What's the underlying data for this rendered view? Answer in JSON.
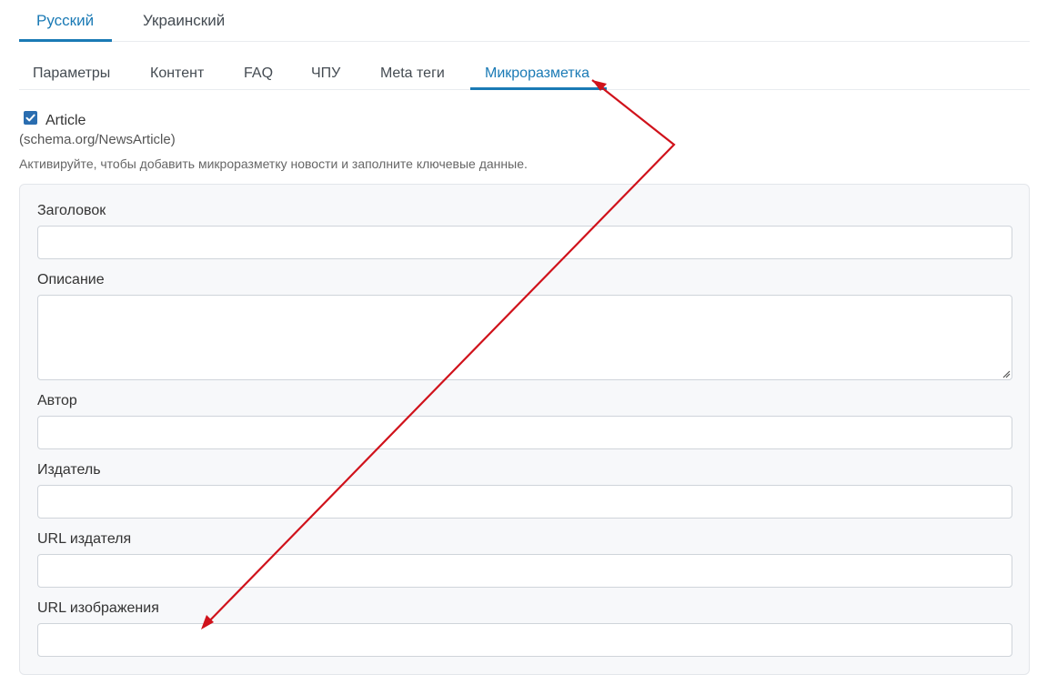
{
  "language_tabs": [
    {
      "label": "Русский",
      "active": true
    },
    {
      "label": "Украинский",
      "active": false
    }
  ],
  "sub_tabs": [
    {
      "label": "Параметры",
      "active": false
    },
    {
      "label": "Контент",
      "active": false
    },
    {
      "label": "FAQ",
      "active": false
    },
    {
      "label": "ЧПУ",
      "active": false
    },
    {
      "label": "Meta теги",
      "active": false
    },
    {
      "label": "Микроразметка",
      "active": true
    }
  ],
  "article_checkbox": {
    "checked": true,
    "label": "Article",
    "schema": "(schema.org/NewsArticle)",
    "help": "Активируйте, чтобы добавить микроразметку новости и заполните ключевые данные."
  },
  "fields": {
    "title": {
      "label": "Заголовок",
      "value": ""
    },
    "description": {
      "label": "Описание",
      "value": ""
    },
    "author": {
      "label": "Автор",
      "value": ""
    },
    "publisher": {
      "label": "Издатель",
      "value": ""
    },
    "publisher_url": {
      "label": "URL издателя",
      "value": ""
    },
    "image_url": {
      "label": "URL изображения",
      "value": ""
    }
  },
  "colors": {
    "accent": "#1a7ab5",
    "annotation_arrow": "#d0121b",
    "panel_bg": "#f7f8fa"
  }
}
